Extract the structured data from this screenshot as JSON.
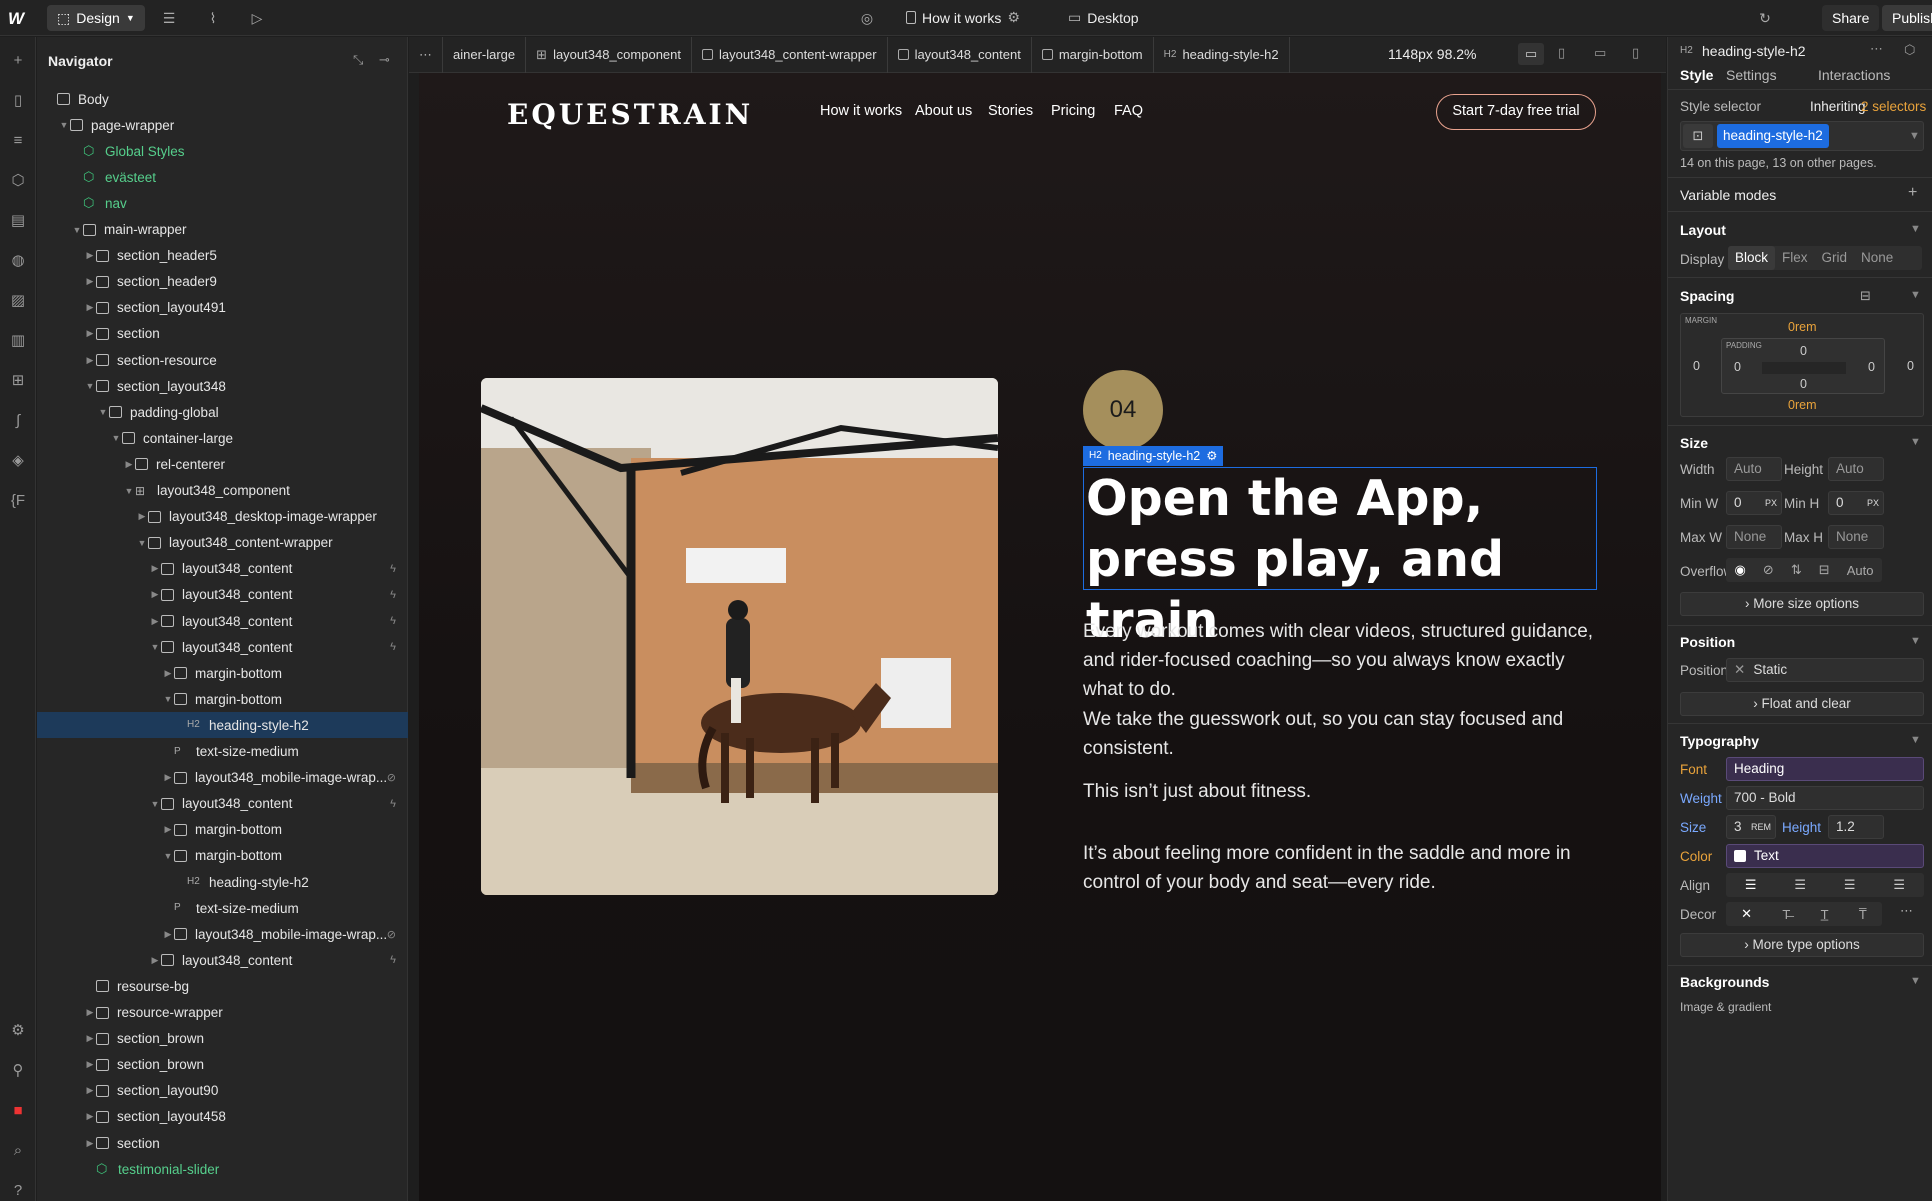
{
  "toolbar": {
    "mode": "Design",
    "page_name": "How it works",
    "device": "Desktop",
    "share": "Share",
    "publish": "Publish",
    "icons": [
      "webflow-logo-icon",
      "design-icon",
      "cms-icon",
      "analytics-icon",
      "play-icon",
      "globe-icon",
      "page-icon",
      "settings-icon",
      "desktop-icon",
      "refresh-icon",
      "comment-icon"
    ]
  },
  "navigator": {
    "title": "Navigator",
    "tree": [
      {
        "label": "Body",
        "depth": 0,
        "type": "box",
        "caret": false
      },
      {
        "label": "page-wrapper",
        "depth": 1,
        "type": "box",
        "caret": "open"
      },
      {
        "label": "Global Styles",
        "depth": 2,
        "type": "symbol",
        "caret": false
      },
      {
        "label": "evästeet",
        "depth": 2,
        "type": "symbol",
        "caret": false
      },
      {
        "label": "nav",
        "depth": 2,
        "type": "symbol",
        "caret": false
      },
      {
        "label": "main-wrapper",
        "depth": 2,
        "type": "box",
        "caret": "open"
      },
      {
        "label": "section_header5",
        "depth": 3,
        "type": "box",
        "caret": "closed"
      },
      {
        "label": "section_header9",
        "depth": 3,
        "type": "box",
        "caret": "closed"
      },
      {
        "label": "section_layout491",
        "depth": 3,
        "type": "box",
        "caret": "closed"
      },
      {
        "label": "section",
        "depth": 3,
        "type": "box",
        "caret": "closed"
      },
      {
        "label": "section-resource",
        "depth": 3,
        "type": "section",
        "caret": "closed"
      },
      {
        "label": "section_layout348",
        "depth": 3,
        "type": "box",
        "caret": "open"
      },
      {
        "label": "padding-global",
        "depth": 4,
        "type": "box",
        "caret": "open"
      },
      {
        "label": "container-large",
        "depth": 5,
        "type": "box",
        "caret": "open"
      },
      {
        "label": "rel-centerer",
        "depth": 6,
        "type": "box",
        "caret": "closed"
      },
      {
        "label": "layout348_component",
        "depth": 6,
        "type": "grid",
        "caret": "open"
      },
      {
        "label": "layout348_desktop-image-wrapper",
        "depth": 7,
        "type": "box",
        "caret": "closed"
      },
      {
        "label": "layout348_content-wrapper",
        "depth": 7,
        "type": "box",
        "caret": "open"
      },
      {
        "label": "layout348_content",
        "depth": 8,
        "type": "box",
        "caret": "closed",
        "bolt": true
      },
      {
        "label": "layout348_content",
        "depth": 8,
        "type": "box",
        "caret": "closed",
        "bolt": true
      },
      {
        "label": "layout348_content",
        "depth": 8,
        "type": "box",
        "caret": "closed",
        "bolt": true
      },
      {
        "label": "layout348_content",
        "depth": 8,
        "type": "box",
        "caret": "open",
        "bolt": true
      },
      {
        "label": "margin-bottom",
        "depth": 9,
        "type": "box",
        "caret": "closed"
      },
      {
        "label": "margin-bottom",
        "depth": 9,
        "type": "box",
        "caret": "open"
      },
      {
        "label": "heading-style-h2",
        "depth": 10,
        "type": "h2",
        "caret": false,
        "selected": true
      },
      {
        "label": "text-size-medium",
        "depth": 9,
        "type": "p",
        "caret": false
      },
      {
        "label": "layout348_mobile-image-wrap...",
        "depth": 9,
        "type": "box",
        "caret": "closed",
        "hidden": true
      },
      {
        "label": "layout348_content",
        "depth": 8,
        "type": "box",
        "caret": "open",
        "bolt": true
      },
      {
        "label": "margin-bottom",
        "depth": 9,
        "type": "box",
        "caret": "closed"
      },
      {
        "label": "margin-bottom",
        "depth": 9,
        "type": "box",
        "caret": "open"
      },
      {
        "label": "heading-style-h2",
        "depth": 10,
        "type": "h2",
        "caret": false
      },
      {
        "label": "text-size-medium",
        "depth": 9,
        "type": "p",
        "caret": false
      },
      {
        "label": "layout348_mobile-image-wrap...",
        "depth": 9,
        "type": "box",
        "caret": "closed",
        "hidden": true
      },
      {
        "label": "layout348_content",
        "depth": 8,
        "type": "box",
        "caret": "closed",
        "bolt": true
      },
      {
        "label": "resourse-bg",
        "depth": 3,
        "type": "box",
        "caret": false
      },
      {
        "label": "resource-wrapper",
        "depth": 3,
        "type": "box",
        "caret": "closed"
      },
      {
        "label": "section_brown",
        "depth": 3,
        "type": "box",
        "caret": "closed"
      },
      {
        "label": "section_brown",
        "depth": 3,
        "type": "box",
        "caret": "closed"
      },
      {
        "label": "section_layout90",
        "depth": 3,
        "type": "box",
        "caret": "closed"
      },
      {
        "label": "section_layout458",
        "depth": 3,
        "type": "box",
        "caret": "closed"
      },
      {
        "label": "section",
        "depth": 3,
        "type": "box",
        "caret": "closed"
      },
      {
        "label": "testimonial-slider",
        "depth": 3,
        "type": "symbol",
        "caret": false
      }
    ]
  },
  "breadcrumb": {
    "items": [
      "ainer-large",
      "layout348_component",
      "layout348_content-wrapper",
      "layout348_content",
      "margin-bottom",
      "heading-style-h2"
    ],
    "width_readout": "1148px 98.2%"
  },
  "site": {
    "brand": "EQUESTRAIN",
    "menu": [
      "How it works",
      "About us",
      "Stories",
      "Pricing",
      "FAQ"
    ],
    "cta": "Start 7-day free trial",
    "step_number": "04",
    "selection_tag": "heading-style-h2",
    "heading": "Open the App, press play, and train",
    "paragraphs": [
      "Every workout comes with clear videos, structured guidance, and rider-focused coaching—so you always know exactly what to do.",
      "We take the guesswork out, so you can stay focused and consistent.",
      "This isn’t just about fitness.",
      "It’s about feeling more confident in the saddle and more in control of your body and seat—every ride."
    ]
  },
  "panel": {
    "element": "heading-style-h2",
    "tabs": [
      "Style",
      "Settings",
      "Interactions"
    ],
    "style_selector_label": "Style selector",
    "inheriting": "Inheriting",
    "inheriting_count": "2 selectors",
    "selector": "heading-style-h2",
    "selector_note": "14 on this page, 13 on other pages.",
    "variable_modes": "Variable modes",
    "layout": {
      "title": "Layout",
      "display_label": "Display",
      "options": [
        "Block",
        "Flex",
        "Grid",
        "None"
      ],
      "active": "Block"
    },
    "spacing": {
      "title": "Spacing",
      "margin_label": "MARGIN",
      "padding_label": "PADDING",
      "margin_top": "0rem",
      "margin_bottom": "0rem",
      "margin_left": "0",
      "margin_right": "0",
      "padding_top": "0",
      "padding_bottom": "0",
      "padding_left": "0",
      "padding_right": "0"
    },
    "size": {
      "title": "Size",
      "width_label": "Width",
      "width": "Auto",
      "height_label": "Height",
      "height": "Auto",
      "minw_label": "Min W",
      "minw": "0",
      "minw_unit": "PX",
      "minh_label": "Min H",
      "minh": "0",
      "minh_unit": "PX",
      "maxw_label": "Max W",
      "maxw": "None",
      "maxh_label": "Max H",
      "maxh": "None",
      "overflow_label": "Overflow",
      "overflow_auto": "Auto",
      "more": "More size options"
    },
    "position": {
      "title": "Position",
      "label": "Position",
      "value": "Static",
      "float": "Float and clear"
    },
    "typography": {
      "title": "Typography",
      "font_label": "Font",
      "font": "Heading",
      "weight_label": "Weight",
      "weight": "700 - Bold",
      "size_label": "Size",
      "size": "3",
      "size_unit": "REM",
      "height_label": "Height",
      "height": "1.2",
      "color_label": "Color",
      "color": "Text",
      "align_label": "Align",
      "decor_label": "Decor",
      "more": "More type options"
    },
    "backgrounds": {
      "title": "Backgrounds",
      "sub": "Image & gradient"
    }
  },
  "colors": {
    "accent": "#1d6ce0",
    "selected_row": "#1d3a5a",
    "badge": "#a58f5c",
    "inherit": "#e9a33b",
    "symbol": "#56cf8c"
  }
}
